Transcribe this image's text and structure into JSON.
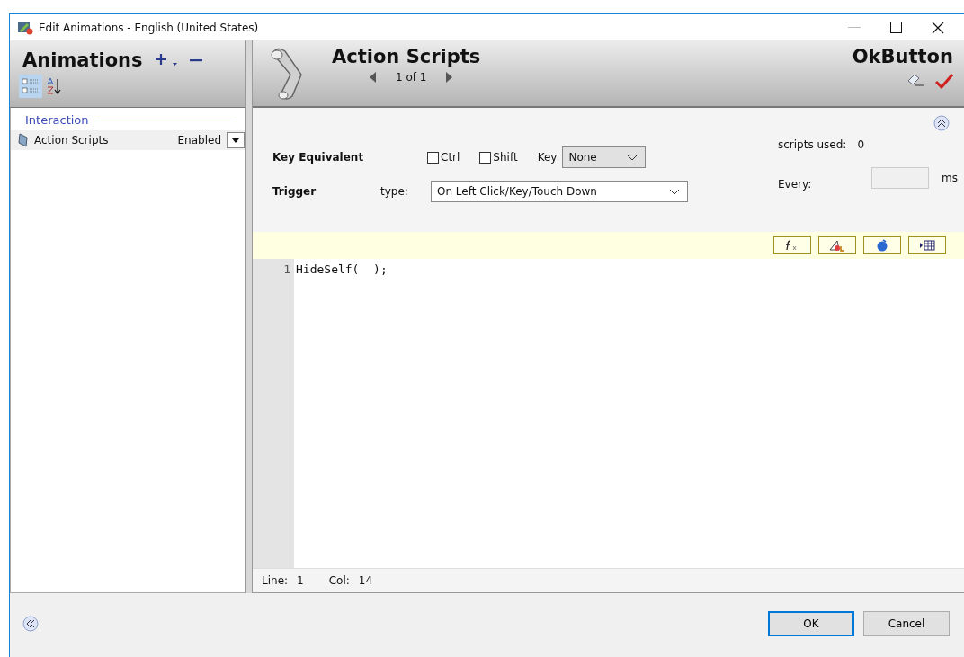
{
  "window": {
    "title": "Edit Animations - English (United States)"
  },
  "animations_panel": {
    "title": "Animations",
    "groups": [
      {
        "label": "Interaction",
        "items": [
          {
            "name": "Action Scripts",
            "status": "Enabled",
            "selected": true
          }
        ]
      }
    ]
  },
  "editor_header": {
    "title": "Action Scripts",
    "pager": "1 of 1",
    "object_name": "OkButton"
  },
  "key_equivalent": {
    "label": "Key Equivalent",
    "options": [
      {
        "label": "Ctrl",
        "checked": false
      },
      {
        "label": "Shift",
        "checked": false
      }
    ],
    "key_label": "Key",
    "key_value": "None"
  },
  "trigger": {
    "label": "Trigger",
    "type_label": "type:",
    "type_value": "On Left Click/Key/Touch Down"
  },
  "scripts_used": {
    "label": "scripts used:",
    "value": "0"
  },
  "every": {
    "label": "Every:",
    "unit": "ms"
  },
  "script_lines": [
    {
      "number": "1",
      "code": "HideSelf(  );"
    }
  ],
  "status": {
    "line_label": "Line:",
    "line": "1",
    "col_label": "Col:",
    "col": "14"
  },
  "buttons": [
    {
      "label": "OK",
      "default": true
    },
    {
      "label": "Cancel",
      "default": false
    }
  ]
}
